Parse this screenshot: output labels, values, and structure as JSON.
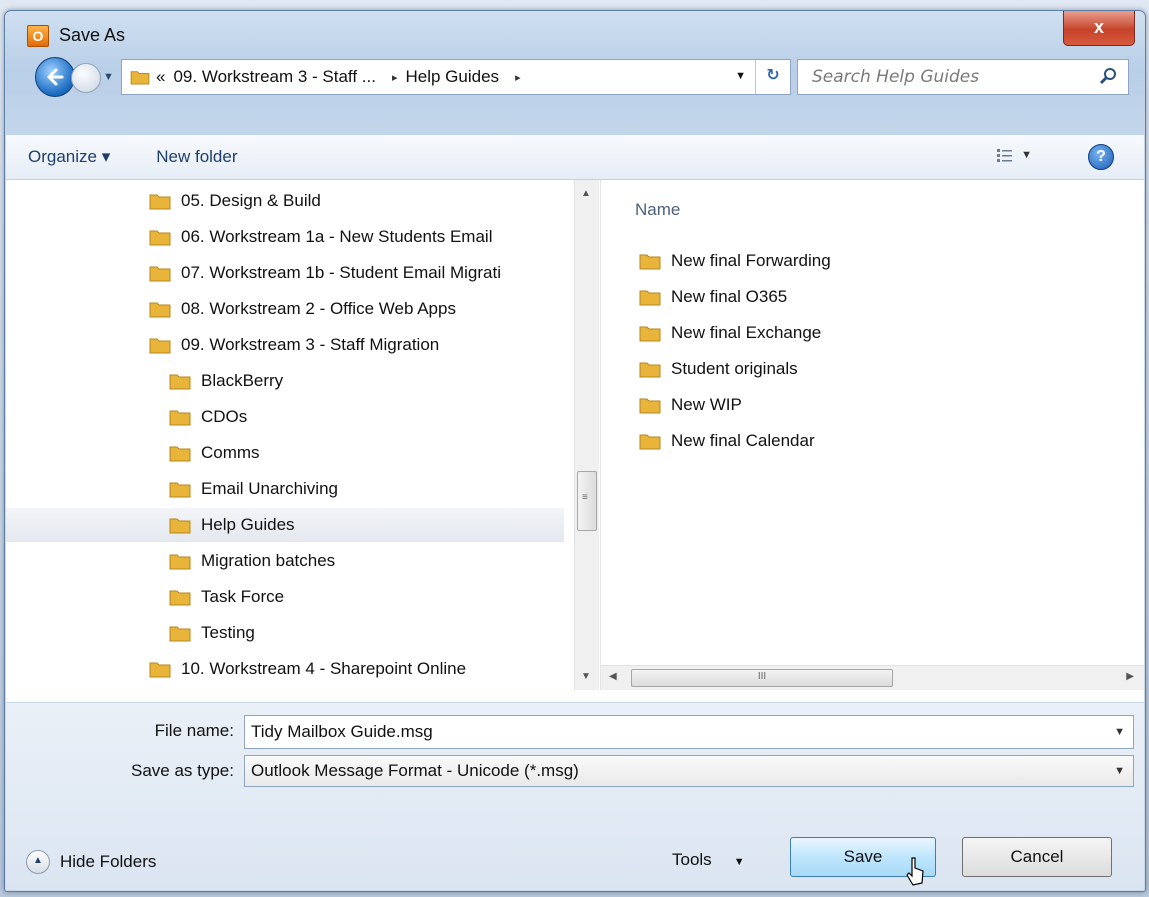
{
  "window": {
    "title": "Save As",
    "close_label": "x"
  },
  "address": {
    "crumb_overflow": "«",
    "crumbs": [
      "09. Workstream 3 - Staff ...",
      "Help Guides"
    ],
    "separator": "▸"
  },
  "search": {
    "placeholder": "Search Help Guides"
  },
  "toolbar": {
    "organize": "Organize ▾",
    "new_folder": "New folder"
  },
  "tree": {
    "items": [
      {
        "label": "05. Design & Build",
        "level": 1
      },
      {
        "label": "06. Workstream 1a - New Students Email",
        "level": 1
      },
      {
        "label": "07. Workstream 1b - Student Email Migrati",
        "level": 1
      },
      {
        "label": "08. Workstream 2 - Office Web Apps",
        "level": 1
      },
      {
        "label": "09. Workstream 3 - Staff Migration",
        "level": 1
      },
      {
        "label": "BlackBerry",
        "level": 2
      },
      {
        "label": "CDOs",
        "level": 2
      },
      {
        "label": "Comms",
        "level": 2
      },
      {
        "label": "Email Unarchiving",
        "level": 2
      },
      {
        "label": "Help Guides",
        "level": 2,
        "selected": true
      },
      {
        "label": "Migration batches",
        "level": 2
      },
      {
        "label": "Task Force",
        "level": 2
      },
      {
        "label": "Testing",
        "level": 2
      },
      {
        "label": "10. Workstream 4 - Sharepoint Online",
        "level": 1
      }
    ]
  },
  "files": {
    "column_name": "Name",
    "items": [
      "New final Forwarding",
      "New final O365",
      "New final Exchange",
      "Student originals",
      "New WIP",
      "New final Calendar"
    ]
  },
  "form": {
    "file_name_label": "File name:",
    "file_name_value": "Tidy Mailbox Guide.msg",
    "save_type_label": "Save as type:",
    "save_type_value": "Outlook Message Format - Unicode (*.msg)"
  },
  "footer": {
    "hide_folders": "Hide Folders",
    "tools": "Tools",
    "save": "Save",
    "cancel": "Cancel"
  },
  "colors": {
    "folder": "#e8b43a",
    "accent": "#3c7fb1",
    "close": "#c7432a"
  }
}
